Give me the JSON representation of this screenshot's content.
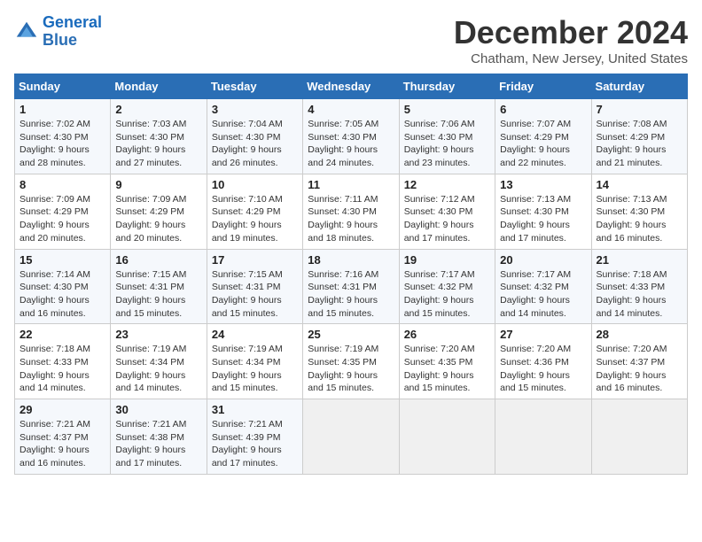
{
  "header": {
    "logo_line1": "General",
    "logo_line2": "Blue",
    "month_title": "December 2024",
    "location": "Chatham, New Jersey, United States"
  },
  "weekdays": [
    "Sunday",
    "Monday",
    "Tuesday",
    "Wednesday",
    "Thursday",
    "Friday",
    "Saturday"
  ],
  "weeks": [
    [
      {
        "day": "1",
        "sunrise": "7:02 AM",
        "sunset": "4:30 PM",
        "daylight": "9 hours and 28 minutes."
      },
      {
        "day": "2",
        "sunrise": "7:03 AM",
        "sunset": "4:30 PM",
        "daylight": "9 hours and 27 minutes."
      },
      {
        "day": "3",
        "sunrise": "7:04 AM",
        "sunset": "4:30 PM",
        "daylight": "9 hours and 26 minutes."
      },
      {
        "day": "4",
        "sunrise": "7:05 AM",
        "sunset": "4:30 PM",
        "daylight": "9 hours and 24 minutes."
      },
      {
        "day": "5",
        "sunrise": "7:06 AM",
        "sunset": "4:30 PM",
        "daylight": "9 hours and 23 minutes."
      },
      {
        "day": "6",
        "sunrise": "7:07 AM",
        "sunset": "4:29 PM",
        "daylight": "9 hours and 22 minutes."
      },
      {
        "day": "7",
        "sunrise": "7:08 AM",
        "sunset": "4:29 PM",
        "daylight": "9 hours and 21 minutes."
      }
    ],
    [
      {
        "day": "8",
        "sunrise": "7:09 AM",
        "sunset": "4:29 PM",
        "daylight": "9 hours and 20 minutes."
      },
      {
        "day": "9",
        "sunrise": "7:09 AM",
        "sunset": "4:29 PM",
        "daylight": "9 hours and 20 minutes."
      },
      {
        "day": "10",
        "sunrise": "7:10 AM",
        "sunset": "4:29 PM",
        "daylight": "9 hours and 19 minutes."
      },
      {
        "day": "11",
        "sunrise": "7:11 AM",
        "sunset": "4:30 PM",
        "daylight": "9 hours and 18 minutes."
      },
      {
        "day": "12",
        "sunrise": "7:12 AM",
        "sunset": "4:30 PM",
        "daylight": "9 hours and 17 minutes."
      },
      {
        "day": "13",
        "sunrise": "7:13 AM",
        "sunset": "4:30 PM",
        "daylight": "9 hours and 17 minutes."
      },
      {
        "day": "14",
        "sunrise": "7:13 AM",
        "sunset": "4:30 PM",
        "daylight": "9 hours and 16 minutes."
      }
    ],
    [
      {
        "day": "15",
        "sunrise": "7:14 AM",
        "sunset": "4:30 PM",
        "daylight": "9 hours and 16 minutes."
      },
      {
        "day": "16",
        "sunrise": "7:15 AM",
        "sunset": "4:31 PM",
        "daylight": "9 hours and 15 minutes."
      },
      {
        "day": "17",
        "sunrise": "7:15 AM",
        "sunset": "4:31 PM",
        "daylight": "9 hours and 15 minutes."
      },
      {
        "day": "18",
        "sunrise": "7:16 AM",
        "sunset": "4:31 PM",
        "daylight": "9 hours and 15 minutes."
      },
      {
        "day": "19",
        "sunrise": "7:17 AM",
        "sunset": "4:32 PM",
        "daylight": "9 hours and 15 minutes."
      },
      {
        "day": "20",
        "sunrise": "7:17 AM",
        "sunset": "4:32 PM",
        "daylight": "9 hours and 14 minutes."
      },
      {
        "day": "21",
        "sunrise": "7:18 AM",
        "sunset": "4:33 PM",
        "daylight": "9 hours and 14 minutes."
      }
    ],
    [
      {
        "day": "22",
        "sunrise": "7:18 AM",
        "sunset": "4:33 PM",
        "daylight": "9 hours and 14 minutes."
      },
      {
        "day": "23",
        "sunrise": "7:19 AM",
        "sunset": "4:34 PM",
        "daylight": "9 hours and 14 minutes."
      },
      {
        "day": "24",
        "sunrise": "7:19 AM",
        "sunset": "4:34 PM",
        "daylight": "9 hours and 15 minutes."
      },
      {
        "day": "25",
        "sunrise": "7:19 AM",
        "sunset": "4:35 PM",
        "daylight": "9 hours and 15 minutes."
      },
      {
        "day": "26",
        "sunrise": "7:20 AM",
        "sunset": "4:35 PM",
        "daylight": "9 hours and 15 minutes."
      },
      {
        "day": "27",
        "sunrise": "7:20 AM",
        "sunset": "4:36 PM",
        "daylight": "9 hours and 15 minutes."
      },
      {
        "day": "28",
        "sunrise": "7:20 AM",
        "sunset": "4:37 PM",
        "daylight": "9 hours and 16 minutes."
      }
    ],
    [
      {
        "day": "29",
        "sunrise": "7:21 AM",
        "sunset": "4:37 PM",
        "daylight": "9 hours and 16 minutes."
      },
      {
        "day": "30",
        "sunrise": "7:21 AM",
        "sunset": "4:38 PM",
        "daylight": "9 hours and 17 minutes."
      },
      {
        "day": "31",
        "sunrise": "7:21 AM",
        "sunset": "4:39 PM",
        "daylight": "9 hours and 17 minutes."
      },
      null,
      null,
      null,
      null
    ]
  ]
}
